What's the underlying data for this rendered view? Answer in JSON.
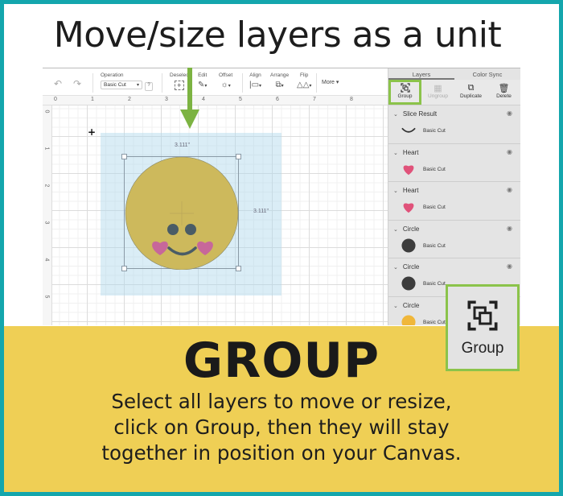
{
  "headline": "Move/size layers as a unit",
  "toolbar": {
    "undo_icon": "undo-icon",
    "redo_icon": "redo-icon",
    "operation_label": "Operation",
    "operation_value": "Basic Cut",
    "help_label": "?",
    "deselect_label": "Deselec",
    "edit_label": "Edit",
    "offset_label": "Offset",
    "align_label": "Align",
    "arrange_label": "Arrange",
    "flip_label": "Flip",
    "more_label": "More ▾"
  },
  "ruler": {
    "top": [
      "0",
      "1",
      "2",
      "3",
      "4",
      "5",
      "6",
      "7",
      "8"
    ],
    "left": [
      "0",
      "1",
      "2",
      "3",
      "4",
      "5"
    ]
  },
  "canvas": {
    "width_dim": "3.111\"",
    "height_dim": "3.111\"",
    "colors": {
      "face": "#cdb95c",
      "eyes": "#4a5c66",
      "cheeks": "#c7679a",
      "selection": "#add8ec"
    }
  },
  "panel": {
    "tabs": [
      {
        "label": "Layers",
        "active": true
      },
      {
        "label": "Color Sync",
        "active": false
      }
    ],
    "actions": [
      {
        "label": "Group",
        "icon": "group-icon",
        "enabled": true,
        "highlighted": true
      },
      {
        "label": "Ungroup",
        "icon": "ungroup-icon",
        "enabled": false,
        "highlighted": false
      },
      {
        "label": "Duplicate",
        "icon": "duplicate-icon",
        "enabled": true,
        "highlighted": false
      },
      {
        "label": "Delete",
        "icon": "trash-icon",
        "enabled": true,
        "highlighted": false
      }
    ],
    "layers": [
      {
        "name": "Slice Result",
        "operation": "Basic Cut",
        "thumb": "smile-curve",
        "color": "#333333"
      },
      {
        "name": "Heart",
        "operation": "Basic Cut",
        "thumb": "heart",
        "color": "#e0527a"
      },
      {
        "name": "Heart",
        "operation": "Basic Cut",
        "thumb": "heart",
        "color": "#e0527a"
      },
      {
        "name": "Circle",
        "operation": "Basic Cut",
        "thumb": "circle",
        "color": "#3d3d3d"
      },
      {
        "name": "Circle",
        "operation": "Basic Cut",
        "thumb": "circle",
        "color": "#3d3d3d"
      },
      {
        "name": "Circle",
        "operation": "Basic Cut",
        "thumb": "circle",
        "color": "#f0b73a"
      }
    ]
  },
  "callout": {
    "label": "Group",
    "icon": "group-icon"
  },
  "banner": {
    "title": "GROUP",
    "lines": [
      "Select all layers to move or resize,",
      "click on Group, then they will stay",
      "together in position on your Canvas."
    ]
  },
  "colors": {
    "frame": "#14a6ad",
    "banner": "#efcf55",
    "highlight": "#8bc34a"
  }
}
